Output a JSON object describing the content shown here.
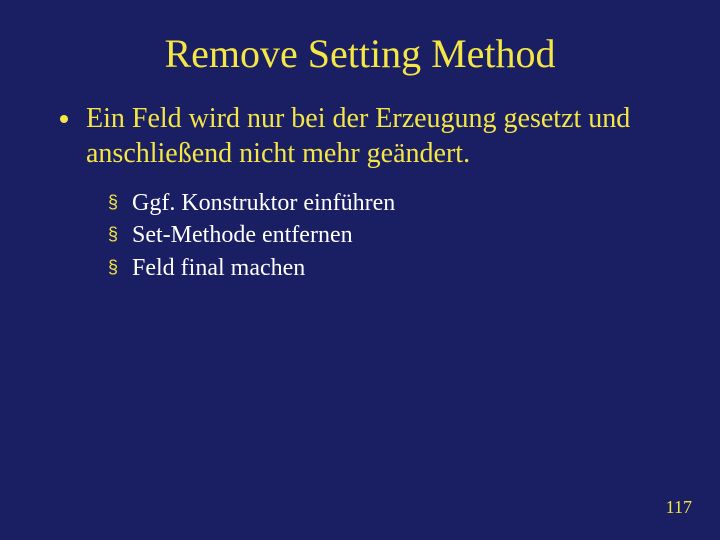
{
  "title": "Remove Setting Method",
  "bullet1": "Ein Feld wird nur bei der Erzeugung gesetzt und anschließend nicht mehr geändert.",
  "sub1": "Ggf. Konstruktor einführen",
  "sub2": "Set-Methode entfernen",
  "sub3": "Feld final machen",
  "page": "117"
}
